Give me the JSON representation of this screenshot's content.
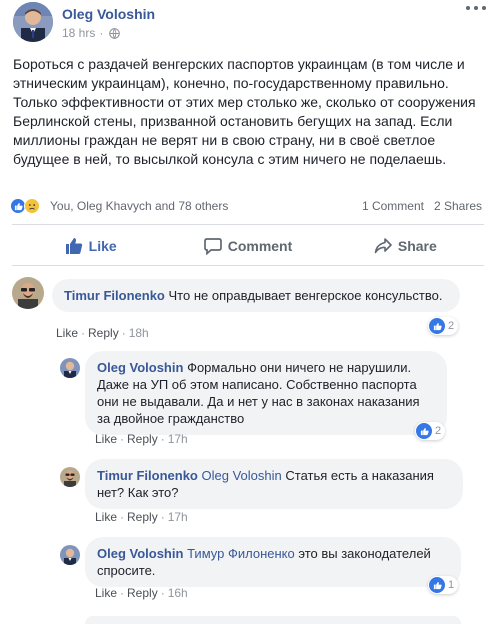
{
  "post": {
    "author": "Oleg Voloshin",
    "time": "18 hrs",
    "text": "Бороться с раздачей венгерских паспортов украинцам (в том числе и этническим украинцам), конечно, по-государственному правильно. Только эффективности от этих мер столько же, сколько от сооружения Берлинской стены, призванной остановить бегущих на запад. Если миллионы граждан не верят ни в свою страну, ни в своё светлое будущее в ней, то высылкой консула с этим ничего не поделаешь.",
    "reactions_names": "You, Oleg Khavych and 78 others",
    "comments_count": "1 Comment",
    "shares_count": "2 Shares"
  },
  "actions": {
    "like": "Like",
    "comment": "Comment",
    "share": "Share"
  },
  "comments": [
    {
      "author": "Timur Filonenko",
      "mention": "",
      "text": "Что не оправдывает венгерское консульство.",
      "like_label": "Like",
      "reply_label": "Reply",
      "time": "18h",
      "likes": "2"
    },
    {
      "author": "Oleg Voloshin",
      "mention": "",
      "text": "Формально они ничего не нарушили. Даже на УП об этом написано. Собственно паспорта они не выдавали. Да и нет у нас в законах наказания за двойное гражданство",
      "like_label": "Like",
      "reply_label": "Reply",
      "time": "17h",
      "likes": "2"
    },
    {
      "author": "Timur Filonenko",
      "mention": "Oleg Voloshin",
      "text": "Статья есть а наказания нет? Как это?",
      "like_label": "Like",
      "reply_label": "Reply",
      "time": "17h",
      "likes": ""
    },
    {
      "author": "Oleg Voloshin",
      "mention": "Тимур Филоненко",
      "text": "это вы законодателей спросите.",
      "like_label": "Like",
      "reply_label": "Reply",
      "time": "16h",
      "likes": "1"
    }
  ],
  "colors": {
    "link": "#385898",
    "like_blue": "#3578e5",
    "bubble": "#f2f3f5"
  }
}
